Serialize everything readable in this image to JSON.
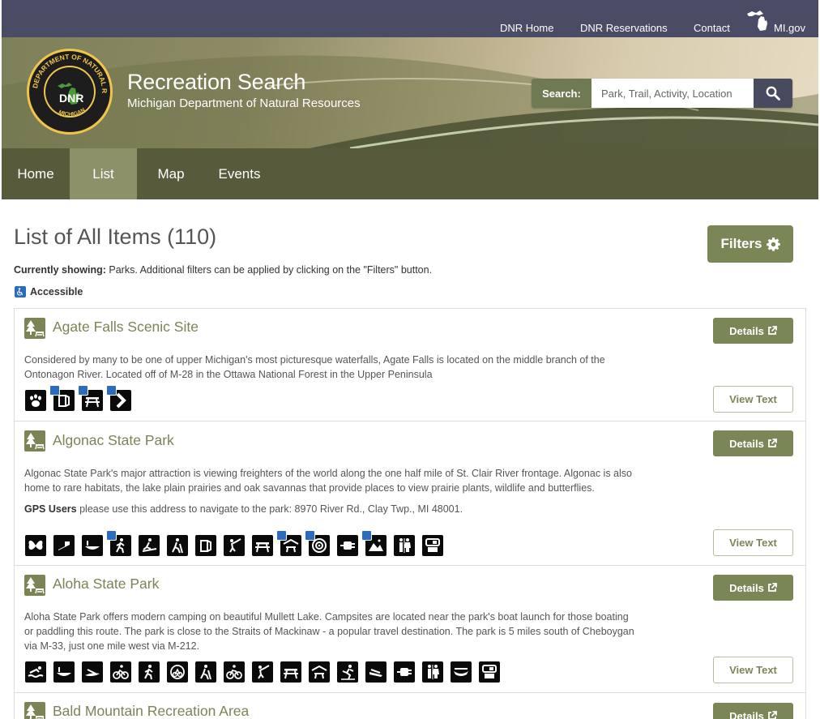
{
  "topbar": {
    "links": [
      "DNR Home",
      "DNR Reservations",
      "Contact",
      "MI.gov"
    ]
  },
  "banner": {
    "seal_text_top": "DEPARTMENT OF NATURAL RESOURCES",
    "seal_text_center": "DNR",
    "seal_text_bottom": "MICHIGAN",
    "title": "Recreation Search",
    "subtitle": "Michigan Department of Natural Resources"
  },
  "search": {
    "label": "Search:",
    "placeholder": "Park, Trail, Activity, Location"
  },
  "nav": {
    "items": [
      "Home",
      "List",
      "Map",
      "Events"
    ],
    "active": "List"
  },
  "main": {
    "heading": "List of All Items (110)",
    "filters_label": "Filters",
    "showing_label": "Currently showing:",
    "showing_text": " Parks. Additional filters can be applied by clicking on the \"Filters\" button.",
    "accessible_label": "Accessible",
    "details_label": "Details",
    "view_text_label": "View Text"
  },
  "items": [
    {
      "title": "Agate Falls Scenic Site",
      "desc_line1": "Considered by many to be one of upper Michigan's most picturesque waterfalls, Agate Falls is located on the middle branch of the",
      "desc_line2": "Ontonagon River. Located off of M-28 in the Ottawa National Forest in the Upper Peninsula",
      "amenity_icons": [
        "wildlife-viewing",
        "restroom",
        "picnic-area",
        "trail"
      ]
    },
    {
      "title": "Algonac State Park",
      "desc_line1": "Algonac State Park's major attraction is viewing freighters of the world along the one half mile of St. Clair River frontage. Algonac is also",
      "desc_line2": "home to rare habitats, the lake plain prairies and oak savannas that provide places to view prairie plants, wildlife and butterflies.",
      "gps_label": "GPS Users",
      "gps_text": " please use this address to navigate to the park: 8970 River Rd., Clay Twp., MI 48001.",
      "amenity_icons": [
        "butterfly",
        "boat-launch",
        "canoe",
        "hiking",
        "cross-country-ski",
        "hiking-trail",
        "restroom",
        "fishing",
        "picnic-area",
        "picnic-shelter",
        "archery",
        "electric-hookup",
        "camping",
        "restrooms",
        "sanitation-station"
      ]
    },
    {
      "title": "Aloha State Park",
      "desc_line1": "Aloha State Park offers modern camping on beautiful Mullett Lake. Campsites are located near the park's boat launch for those boating",
      "desc_line2": "or paddling this route. The park is close to the Straits of Mackinaw - a popular travel destination. The park is 5 miles south of Cheboygan",
      "desc_line3": "via M-33, just one mile west via M-212.",
      "amenity_icons": [
        "swimming",
        "canoe",
        "kayak",
        "biking",
        "hiking",
        "mountain-bike",
        "hiking-trail",
        "bike-trail",
        "fishing",
        "picnic-area",
        "picnic-shelter",
        "playground",
        "boat-launch",
        "electric-hookup",
        "restrooms",
        "rowboat",
        "sanitation-station"
      ]
    },
    {
      "title": "Bald Mountain Recreation Area"
    }
  ]
}
